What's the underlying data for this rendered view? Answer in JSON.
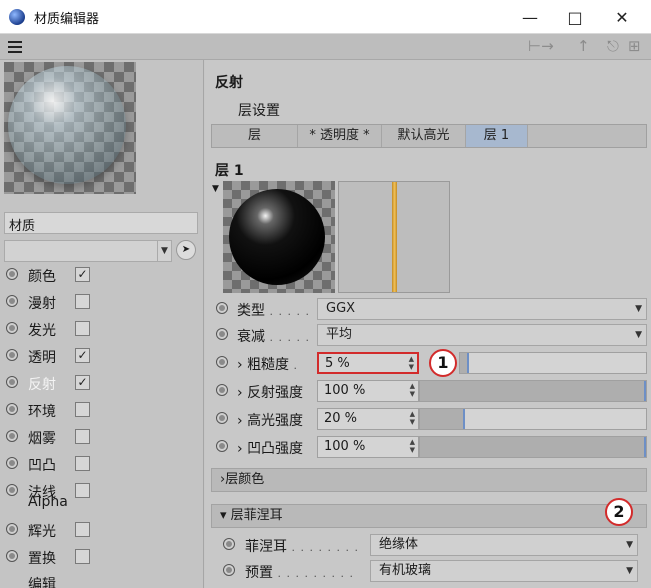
{
  "window": {
    "title": "材质编辑器"
  },
  "material": {
    "name": "材质"
  },
  "channels": [
    {
      "label": "颜色",
      "checked": true,
      "active": false
    },
    {
      "label": "漫射",
      "checked": false,
      "active": false
    },
    {
      "label": "发光",
      "checked": false,
      "active": false
    },
    {
      "label": "透明",
      "checked": true,
      "active": false
    },
    {
      "label": "反射",
      "checked": true,
      "active": true
    },
    {
      "label": "环境",
      "checked": false,
      "active": false
    },
    {
      "label": "烟雾",
      "checked": false,
      "active": false
    },
    {
      "label": "凹凸",
      "checked": false,
      "active": false
    },
    {
      "label": "法线",
      "checked": false,
      "active": false
    },
    {
      "label": "Alpha",
      "checked": false,
      "active": false
    },
    {
      "label": "辉光",
      "checked": false,
      "active": false
    },
    {
      "label": "置换",
      "checked": false,
      "active": false
    },
    {
      "label": "编辑",
      "checked": null,
      "active": false
    }
  ],
  "reflection": {
    "title": "反射",
    "layer_settings": "层设置",
    "tabs": [
      "层",
      "* 透明度 *",
      "默认高光",
      "层 1"
    ],
    "active_tab": 3,
    "layer_title": "层 1",
    "params": {
      "type": {
        "label": "类型",
        "value": "GGX"
      },
      "falloff": {
        "label": "衰减",
        "value": "平均"
      },
      "roughness": {
        "label": "粗糙度",
        "value": "5 %",
        "fraction": 0.05
      },
      "reflect_strength": {
        "label": "反射强度",
        "value": "100 %",
        "fraction": 1.0
      },
      "specular_strength": {
        "label": "高光强度",
        "value": "20 %",
        "fraction": 0.2
      },
      "bump_strength": {
        "label": "凹凸强度",
        "value": "100 %",
        "fraction": 1.0
      }
    },
    "layer_color": "层颜色",
    "fresnel_group": "层菲涅耳",
    "fresnel": {
      "label": "菲涅耳",
      "value": "绝缘体"
    },
    "preset": {
      "label": "预置",
      "value": "有机玻璃"
    }
  },
  "annotations": [
    "1",
    "2"
  ],
  "colors": {
    "highlight": "#d22b2b",
    "active_tab": "#a7b8cf",
    "active_channel_text": "#f4f4f4"
  }
}
